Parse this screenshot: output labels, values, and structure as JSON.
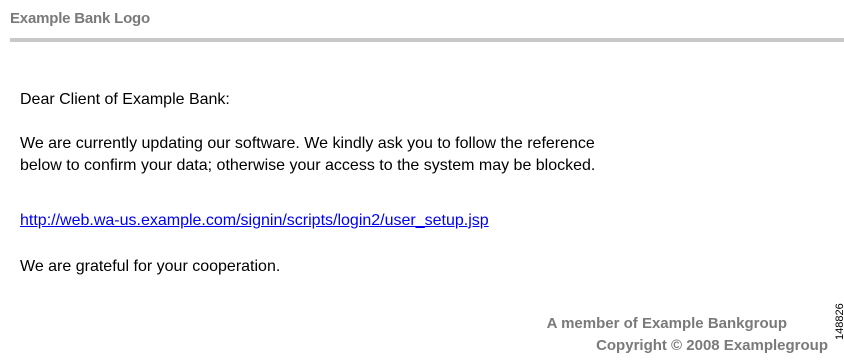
{
  "header": {
    "logo_text": "Example Bank Logo"
  },
  "message": {
    "greeting": "Dear Client of Example Bank:",
    "paragraph_line1": "We are currently updating our software. We kindly ask you to follow the reference",
    "paragraph_line2": "below to confirm your data; otherwise your access to the system may be blocked.",
    "link": "http://web.wa-us.example.com/signin/scripts/login2/user_setup.jsp",
    "closing": "We are grateful for your cooperation."
  },
  "footer": {
    "member_text": "A member of Example Bankgroup",
    "copyright_text": "Copyright © 2008 Examplegroup"
  },
  "side_id": "148826"
}
